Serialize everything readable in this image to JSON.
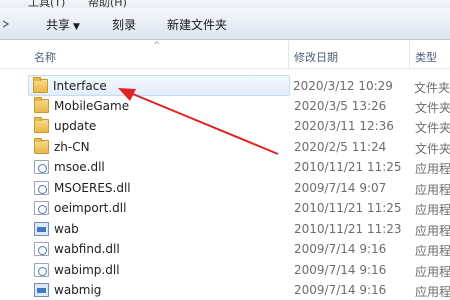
{
  "menu": {
    "items": [
      "工具(T)",
      "帮助(H)"
    ]
  },
  "toolbar": {
    "share_label": "共享",
    "burn_label": "刻录",
    "new_folder_label": "新建文件夹"
  },
  "columns": {
    "name": "名称",
    "date": "修改日期",
    "type": "类型"
  },
  "files": [
    {
      "name": "Interface",
      "date": "2020/3/12 10:29",
      "type": "文件夹",
      "icon": "folder-icon"
    },
    {
      "name": "MobileGame",
      "date": "2020/3/5 13:26",
      "type": "文件夹",
      "icon": "folder-icon"
    },
    {
      "name": "update",
      "date": "2020/3/11 12:36",
      "type": "文件夹",
      "icon": "folder-icon"
    },
    {
      "name": "zh-CN",
      "date": "2020/2/5 11:24",
      "type": "文件夹",
      "icon": "folder-icon"
    },
    {
      "name": "msoe.dll",
      "date": "2010/11/21 11:25",
      "type": "应用程序",
      "icon": "dll-icon"
    },
    {
      "name": "MSOERES.dll",
      "date": "2009/7/14 9:07",
      "type": "应用程序",
      "icon": "dll-icon"
    },
    {
      "name": "oeimport.dll",
      "date": "2010/11/21 11:25",
      "type": "应用程序",
      "icon": "dll-icon"
    },
    {
      "name": "wab",
      "date": "2010/11/21 11:23",
      "type": "应用程序",
      "icon": "exe-icon"
    },
    {
      "name": "wabfind.dll",
      "date": "2009/7/14 9:16",
      "type": "应用程序",
      "icon": "dll-icon"
    },
    {
      "name": "wabimp.dll",
      "date": "2009/7/14 9:16",
      "type": "应用程序",
      "icon": "dll-icon"
    },
    {
      "name": "wabmig",
      "date": "2009/7/14 9:16",
      "type": "应用程序",
      "icon": "exe-icon"
    }
  ],
  "colors": {
    "accent_arrow": "#e02424",
    "toolbar_top": "#f5f8fc",
    "toolbar_bottom": "#dde6f1",
    "header_text": "#4c607a",
    "selection": "#e3eefa"
  }
}
